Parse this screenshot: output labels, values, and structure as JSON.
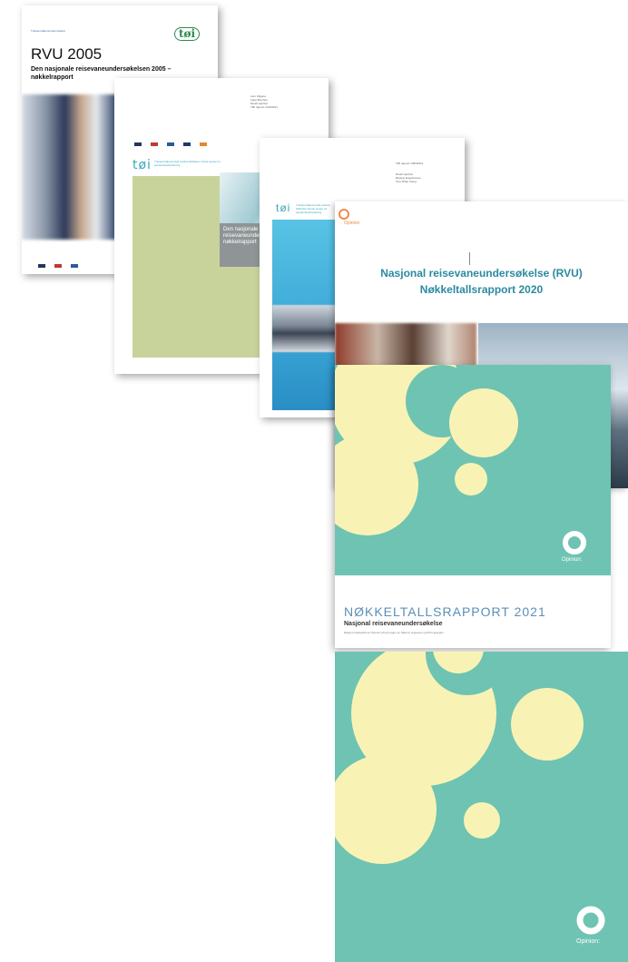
{
  "colors": {
    "teal": "#6fc3b2",
    "cream": "#f8f3b4",
    "green_panel": "#c8d39c",
    "toi_teal": "#3aa6bb",
    "opinion_orange": "#f08a4b",
    "rvu2020_title": "#2b8aa0"
  },
  "cover1": {
    "institute": "Transportøkonomisk institutt",
    "logo": "tøi",
    "title": "RVU 2005",
    "subtitle": "Den nasjonale reisevaneundersøkelsen 2005 – nøkkelrapport"
  },
  "cover2": {
    "authors": [
      "Lars Vågane",
      "Ingar Brechan",
      "Randi Hjorthol",
      "TØI rapport 1130/2011"
    ],
    "logo": "tøi",
    "institute_line": "Transportøkonomisk institutt Stiftelsen Norsk senter for samferdselsforskning",
    "title_fragment": "Den nasjonale reisevaneundersøkelsen nøkkelrapport"
  },
  "cover3": {
    "report_no": "TØI rapport 1383/2014",
    "authors": [
      "Randi Hjorthol",
      "Øystein Engebretsen",
      "Tore Philip Uteng"
    ],
    "logo": "tøi",
    "institute_line": "Transportøkonomisk institutt Stiftelsen Norsk senter for samferdselsforskning"
  },
  "cover4": {
    "logo_text": "Opinion",
    "title_line1": "Nasjonal reisevaneundersøkelse (RVU)",
    "title_line2": "Nøkkeltallsrapport 2020"
  },
  "cover5": {
    "logo_text": "Opinion:",
    "title": "NØKKELTALLSRAPPORT 2021",
    "subtitle": "Nasjonal reisevaneundersøkelse",
    "description": "Rapport utarbeidet av Opinion AS på vegne av Statens vegvesen og RVU-gruppen"
  },
  "cover6": {
    "logo_text": "Opinion:"
  }
}
